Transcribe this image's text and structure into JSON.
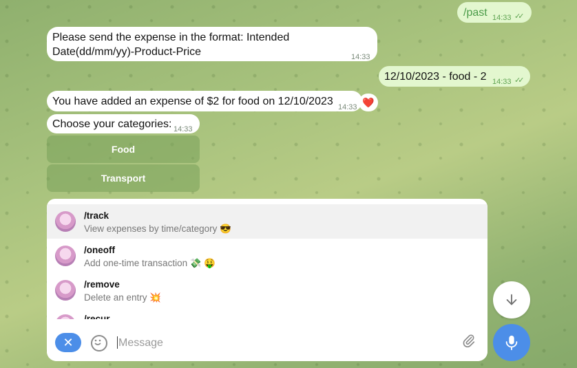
{
  "messages": [
    {
      "type": "out",
      "text": "/past",
      "time": "14:33"
    },
    {
      "type": "in",
      "text": "Please send the expense in the format: Intended Date(dd/mm/yy)-Product-Price",
      "time": "14:33"
    },
    {
      "type": "out",
      "text": "12/10/2023 - food - 2",
      "time": "14:33"
    },
    {
      "type": "in",
      "text": "You have added an expense of $2 for food on 12/10/2023",
      "time": "14:33",
      "reaction": "❤️"
    },
    {
      "type": "in",
      "text": "Choose your categories:",
      "time": "14:33"
    }
  ],
  "keyboard": [
    "Food",
    "Transport"
  ],
  "commands": [
    {
      "name": "/track",
      "desc": "View expenses by time/category 😎",
      "selected": true
    },
    {
      "name": "/oneoff",
      "desc": "Add one-time transaction 💸 🤑",
      "selected": false
    },
    {
      "name": "/remove",
      "desc": "Delete an entry 💥",
      "selected": false
    },
    {
      "name": "/recur",
      "desc": "",
      "selected": false
    }
  ],
  "composer": {
    "placeholder": "Message",
    "value": ""
  },
  "icons": {
    "cancel": "close-icon",
    "emoji": "smile-icon",
    "attach": "paperclip-icon",
    "scroll_down": "arrow-down-icon",
    "mic": "microphone-icon"
  },
  "colors": {
    "accent": "#4c8ee8",
    "outgoing_bubble": "#e3f7cf",
    "incoming_bubble": "#ffffff"
  }
}
